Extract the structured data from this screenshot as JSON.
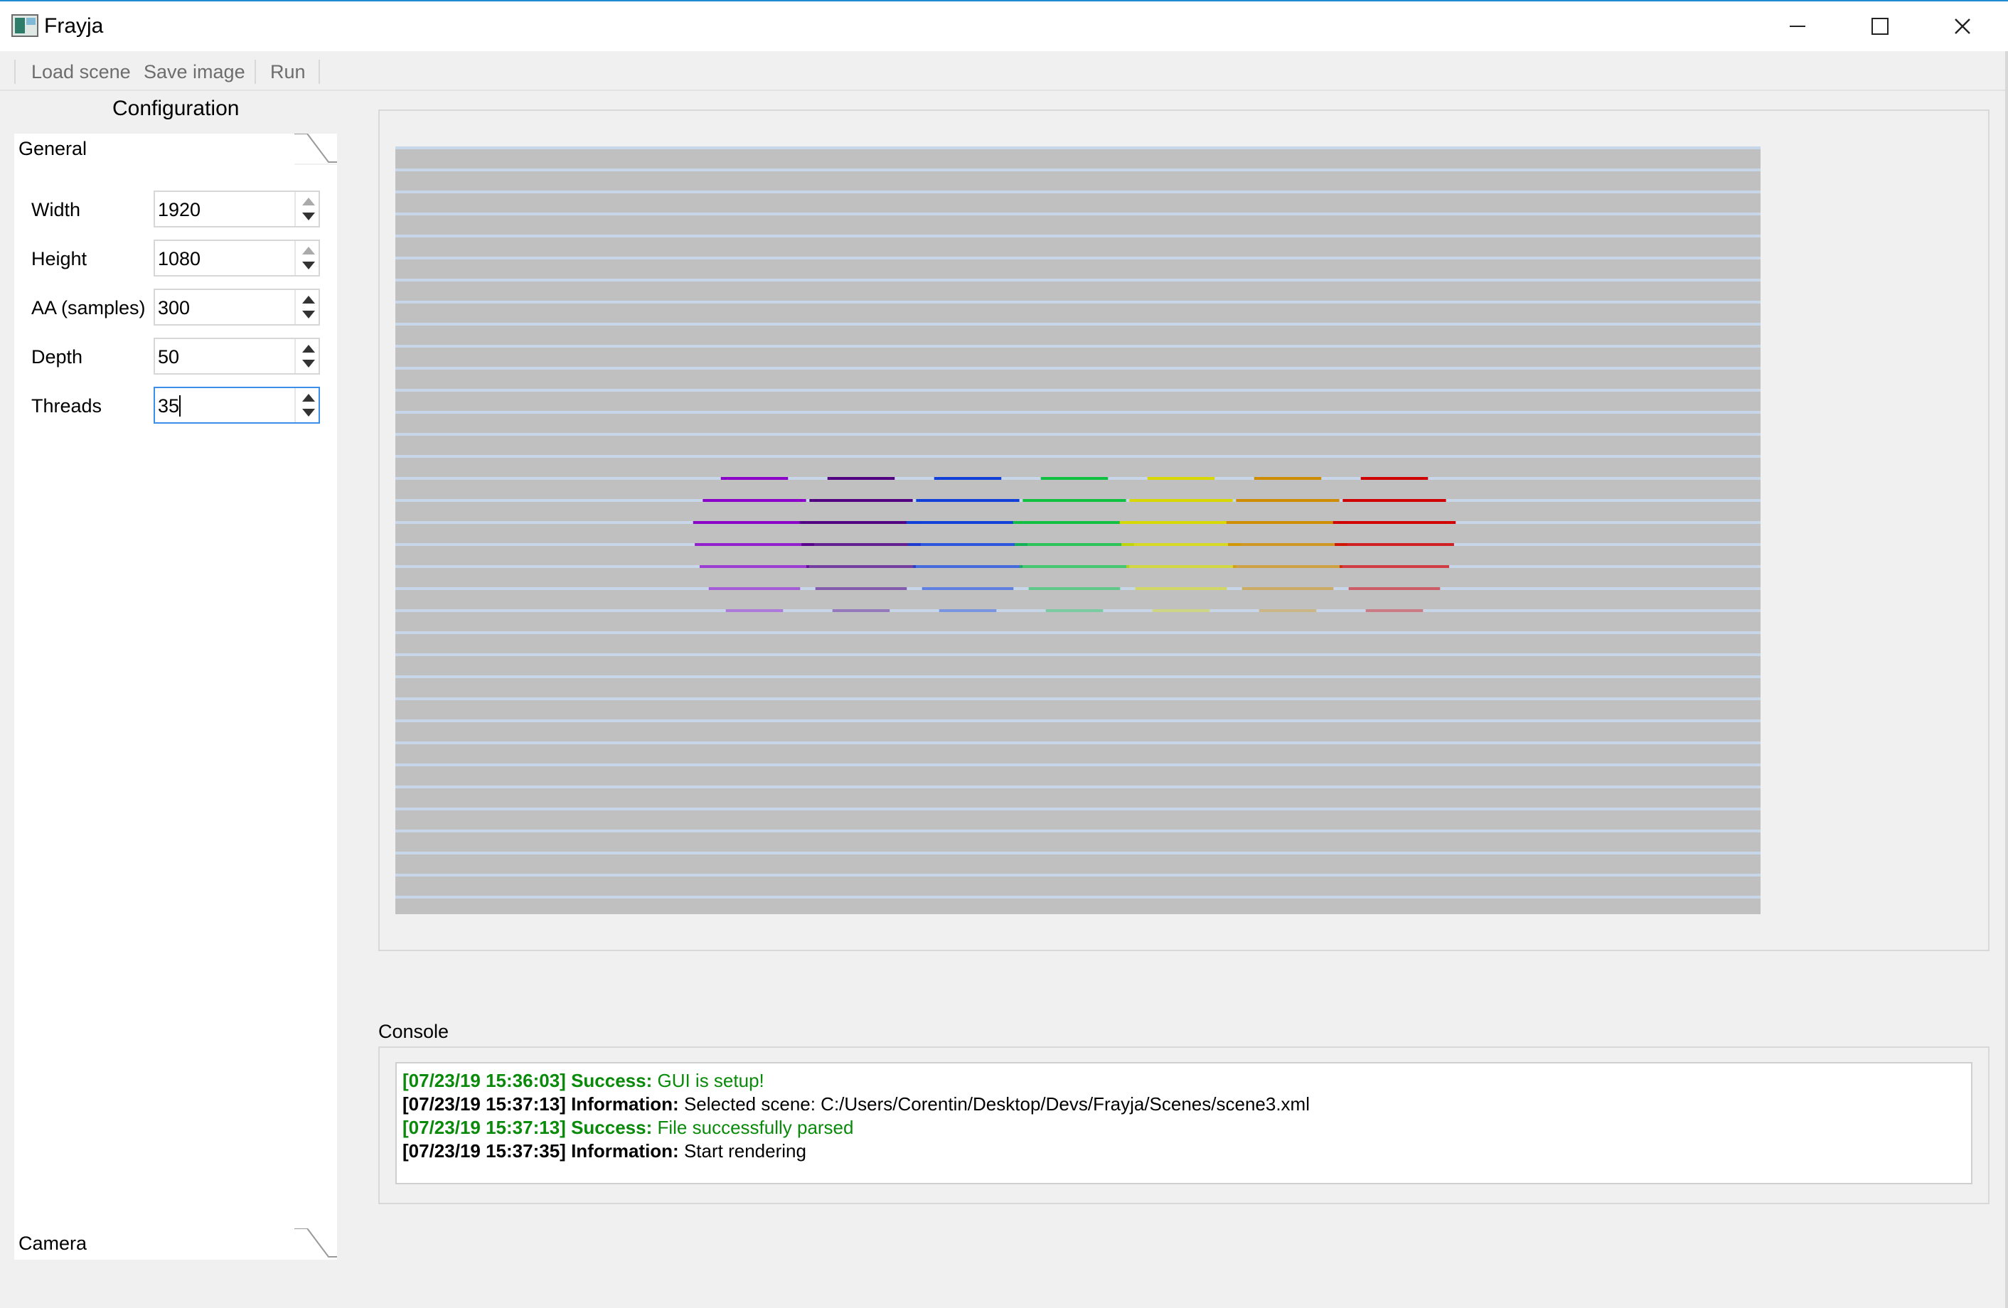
{
  "window": {
    "title": "Frayja"
  },
  "toolbar": {
    "items": [
      "Load scene",
      "Save image",
      "Run"
    ]
  },
  "config": {
    "title": "Configuration",
    "tabs": {
      "general": "General",
      "camera": "Camera"
    },
    "fields": [
      {
        "label": "Width",
        "value": "1920"
      },
      {
        "label": "Height",
        "value": "1080"
      },
      {
        "label": "AA (samples)",
        "value": "300"
      },
      {
        "label": "Depth",
        "value": "50"
      },
      {
        "label": "Threads",
        "value": "35"
      }
    ]
  },
  "render": {
    "background": "#c0c0c0",
    "stripe_color": "#c8d6ea",
    "sphere_colors": [
      "#8a00c8",
      "#500080",
      "#1040d8",
      "#10c040",
      "#d8d800",
      "#d08c00",
      "#d00000"
    ]
  },
  "console": {
    "label": "Console",
    "lines": [
      {
        "timestamp": "[07/23/19 15:36:03]",
        "level": "Success:",
        "message": "GUI is setup!",
        "kind": "success"
      },
      {
        "timestamp": "[07/23/19 15:37:13]",
        "level": "Information:",
        "message": "Selected scene: C:/Users/Corentin/Desktop/Devs/Frayja/Scenes/scene3.xml",
        "kind": "info"
      },
      {
        "timestamp": "[07/23/19 15:37:13]",
        "level": "Success:",
        "message": "File successfully parsed",
        "kind": "success"
      },
      {
        "timestamp": "[07/23/19 15:37:35]",
        "level": "Information:",
        "message": "Start rendering",
        "kind": "info"
      }
    ]
  }
}
